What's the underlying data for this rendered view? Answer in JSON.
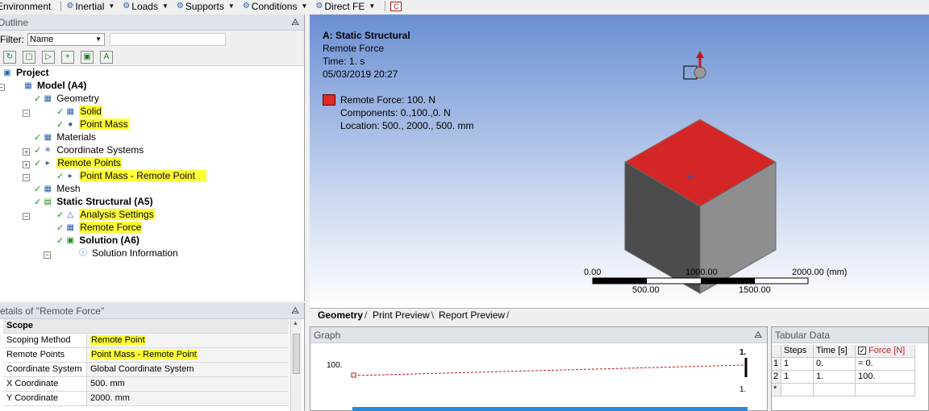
{
  "toolbar": {
    "items": [
      "Environment",
      "Inertial",
      "Loads",
      "Supports",
      "Conditions",
      "Direct FE"
    ]
  },
  "outline": {
    "title": "Outline",
    "filter_label": "Filter:",
    "filter_value": "Name",
    "tree": {
      "project": "Project",
      "model": "Model (A4)",
      "geometry": "Geometry",
      "solid": "Solid",
      "point_mass": "Point Mass",
      "materials": "Materials",
      "coordinate_systems": "Coordinate Systems",
      "remote_points": "Remote Points",
      "remote_point_child": "Point Mass - Remote Point",
      "mesh": "Mesh",
      "static_structural": "Static Structural (A5)",
      "analysis_settings": "Analysis Settings",
      "remote_force": "Remote Force",
      "solution": "Solution (A6)",
      "solution_information": "Solution Information"
    }
  },
  "details": {
    "title": "etails of \"Remote Force\"",
    "scope_header": "Scope",
    "rows": [
      {
        "key": "Scoping Method",
        "value": "Remote Point"
      },
      {
        "key": "Remote Points",
        "value": "Point Mass - Remote Point"
      },
      {
        "key": "Coordinate System",
        "value": "Global Coordinate System"
      },
      {
        "key": "X Coordinate",
        "value": "500. mm"
      },
      {
        "key": "Y Coordinate",
        "value": "2000. mm"
      }
    ]
  },
  "viewport": {
    "title": "A: Static Structural",
    "subtitle": "Remote Force",
    "time": "Time: 1. s",
    "date": "05/03/2019 20:27",
    "legend_label": "Remote Force: 100. N",
    "components": "Components: 0.,100.,0. N",
    "location": "Location: 500., 2000., 500. mm",
    "scale_bar": {
      "l0": "0.00",
      "l1": "1000.00",
      "l2": "2000.00 (mm)",
      "l3": "500.00",
      "l4": "1500.00"
    },
    "tabs": [
      "Geometry",
      "Print Preview",
      "Report Preview"
    ]
  },
  "graph": {
    "title": "Graph",
    "y_label": "100.",
    "right_top": "1.",
    "right_bottom": "1."
  },
  "tabular": {
    "title": "Tabular Data",
    "headers": [
      "Steps",
      "Time [s]",
      "Force [N]"
    ],
    "rows": [
      {
        "n": "1",
        "steps": "1",
        "time": "0.",
        "force": "= 0."
      },
      {
        "n": "2",
        "steps": "1",
        "time": "1.",
        "force": "100."
      }
    ],
    "new_row_marker": "*"
  },
  "colors": {
    "highlight": "#ffff33",
    "force_red": "#e02a2a",
    "check_green": "#1a8a1a"
  }
}
